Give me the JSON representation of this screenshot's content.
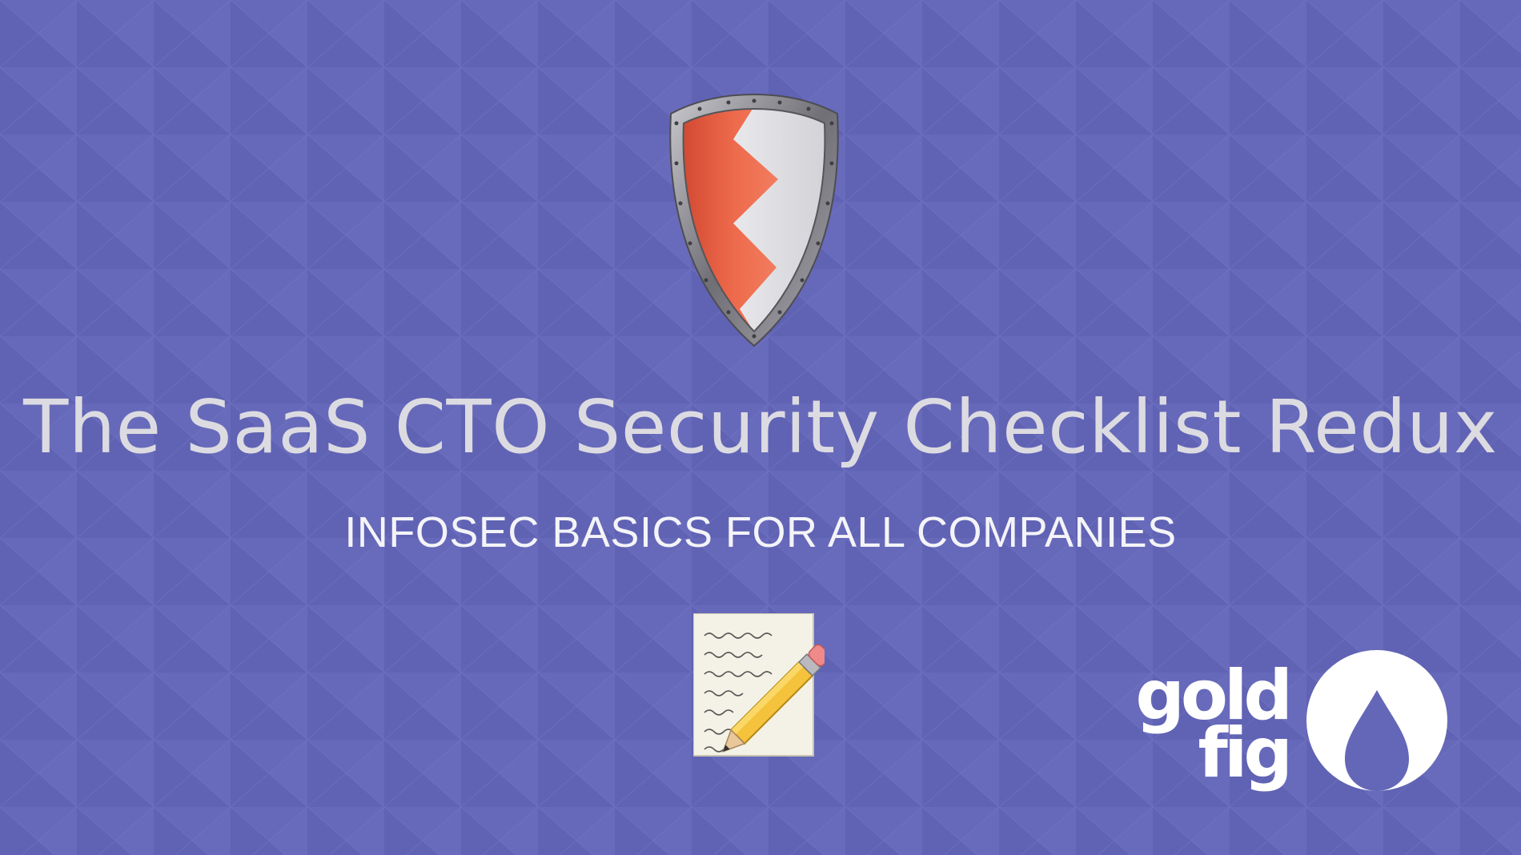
{
  "title": "The SaaS CTO Security Checklist Redux",
  "subtitle": "INFOSEC BASICS FOR ALL COMPANIES",
  "logo": {
    "line1": "gold",
    "line2": "fig"
  },
  "icons": {
    "shield": "shield-icon",
    "notepad": "notepad-pencil-icon",
    "logo_mark": "flame-circle-icon"
  },
  "colors": {
    "background": "#6467b8",
    "title": "#dcdbe1",
    "subtitle": "#f4f4f8",
    "shield_red": "#e85a3c",
    "shield_white": "#e9e9ec",
    "shield_rim": "#8e8e94"
  }
}
